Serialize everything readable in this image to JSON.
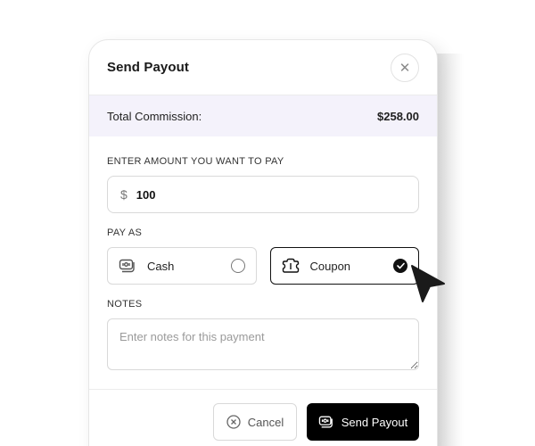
{
  "dialog": {
    "title": "Send Payout",
    "close_icon": "close-icon"
  },
  "commission": {
    "label": "Total Commission:",
    "value": "$258.00"
  },
  "amount": {
    "label": "ENTER AMOUNT YOU WANT TO PAY",
    "currency_symbol": "$",
    "value": "100"
  },
  "pay_as": {
    "label": "PAY AS",
    "options": [
      {
        "label": "Cash",
        "icon": "cash-icon",
        "selected": false
      },
      {
        "label": "Coupon",
        "icon": "coupon-icon",
        "selected": true
      }
    ]
  },
  "notes": {
    "label": "NOTES",
    "placeholder": "Enter notes for this payment",
    "value": ""
  },
  "footer": {
    "cancel_label": "Cancel",
    "send_label": "Send Payout"
  },
  "colors": {
    "accent": "#000000",
    "commission_bg": "#f4f2fb"
  }
}
